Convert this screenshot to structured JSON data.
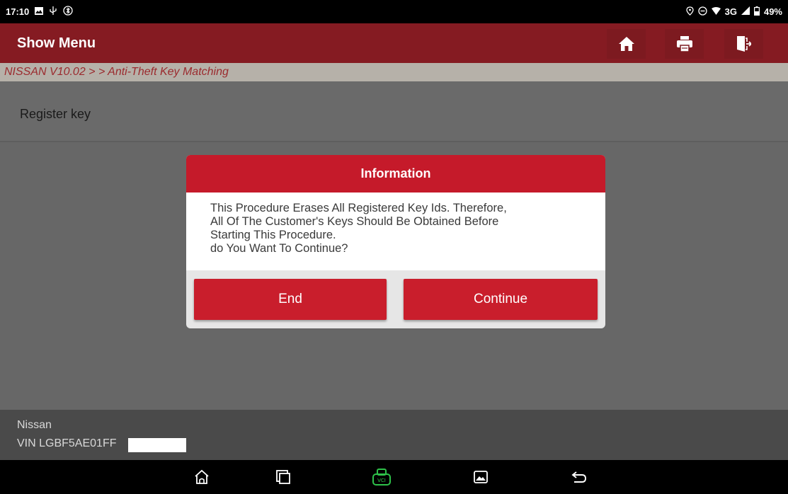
{
  "status_bar": {
    "time": "17:10",
    "battery": "49%",
    "network": "3G"
  },
  "titlebar": {
    "title": "Show Menu",
    "home_icon": "home-icon",
    "print_icon": "printer-icon",
    "exit_icon": "exit-icon"
  },
  "breadcrumb": "NISSAN V10.02 > > Anti-Theft Key Matching",
  "menu": {
    "items": [
      {
        "label": "Register key"
      }
    ]
  },
  "dialog": {
    "title": "Information",
    "lines": [
      "This Procedure Erases All Registered Key Ids. Therefore,",
      "All Of The Customer's Keys Should Be Obtained Before",
      "Starting This Procedure.",
      "do You Want To Continue?"
    ],
    "end_label": "End",
    "continue_label": "Continue"
  },
  "footer": {
    "make": "Nissan",
    "vin": "VIN LGBF5AE01FF"
  },
  "colors": {
    "titlebar": "#851b22",
    "dialog_header": "#c51a2a",
    "button": "#c91e2c",
    "vci_icon": "#2ec24a"
  }
}
